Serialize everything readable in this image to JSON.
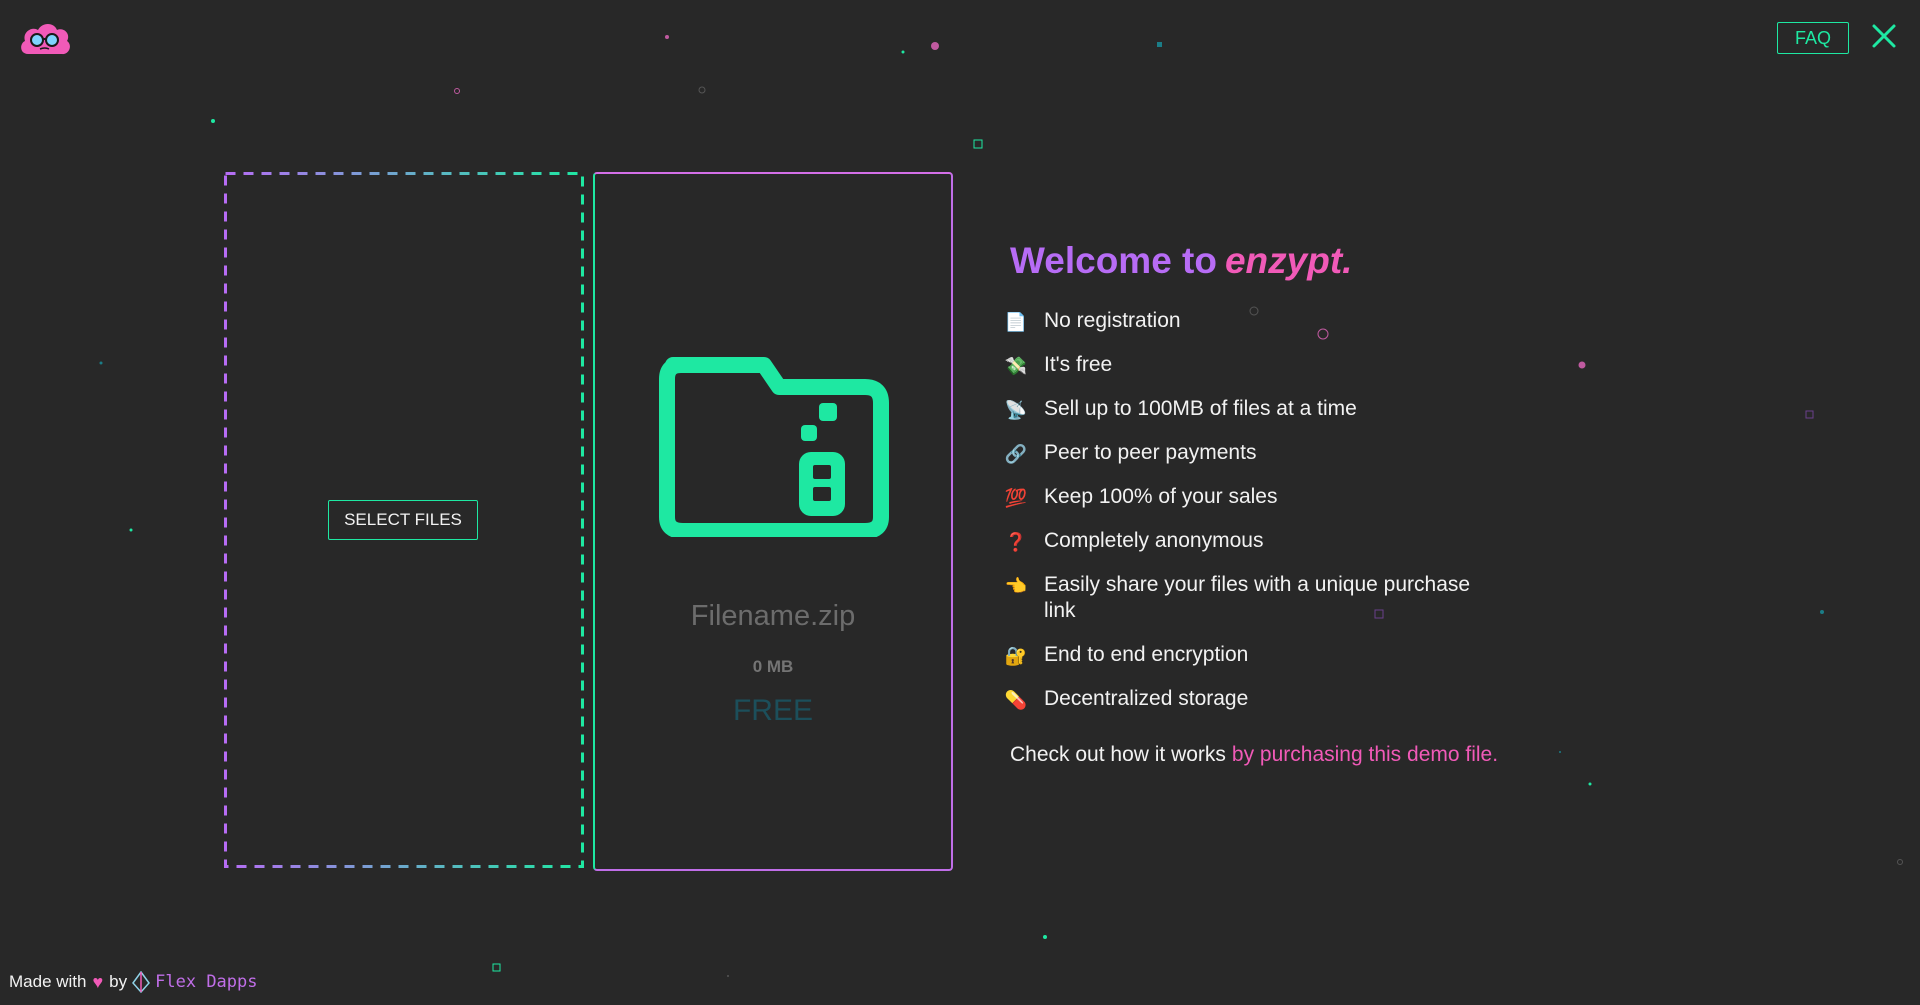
{
  "header": {
    "logo": "enzypt-cloud-glasses-logo",
    "faq_label": "FAQ",
    "close_icon": "close-icon"
  },
  "dropzone": {
    "select_files_label": "SELECT FILES"
  },
  "preview": {
    "icon": "encrypted-folder-icon",
    "file_name": "Filename.zip",
    "file_size": "0 MB",
    "price": "FREE"
  },
  "welcome": {
    "prefix": "Welcome to",
    "brand": "enzypt."
  },
  "features": [
    {
      "icon": "document-icon",
      "emoji": "📄",
      "label": "No registration"
    },
    {
      "icon": "money-wings-icon",
      "emoji": "💸",
      "label": "It's free"
    },
    {
      "icon": "antenna-icon",
      "emoji": "📡",
      "label": "Sell up to 100MB of files at a time"
    },
    {
      "icon": "link-icon",
      "emoji": "🔗",
      "label": "Peer to peer payments"
    },
    {
      "icon": "hundred-icon",
      "emoji": "💯",
      "label": "Keep 100% of your sales"
    },
    {
      "icon": "question-icon",
      "emoji": "❓",
      "label": "Completely anonymous"
    },
    {
      "icon": "pointing-hand-icon",
      "emoji": "👈",
      "label": "Easily share your files with a unique purchase link"
    },
    {
      "icon": "lock-icon",
      "emoji": "🔐",
      "label": "End to end encryption"
    },
    {
      "icon": "pill-icon",
      "emoji": "💊",
      "label": "Decentralized storage"
    }
  ],
  "demo": {
    "prefix": "Check out how it works",
    "link_label": "by purchasing this demo file."
  },
  "footer": {
    "made_with": "Made with",
    "by": "by",
    "author": "Flex Dapps"
  },
  "colors": {
    "background": "#282828",
    "accent_green": "#1ee8a2",
    "accent_purple": "#b76cf5",
    "accent_pink": "#f15ab8"
  }
}
